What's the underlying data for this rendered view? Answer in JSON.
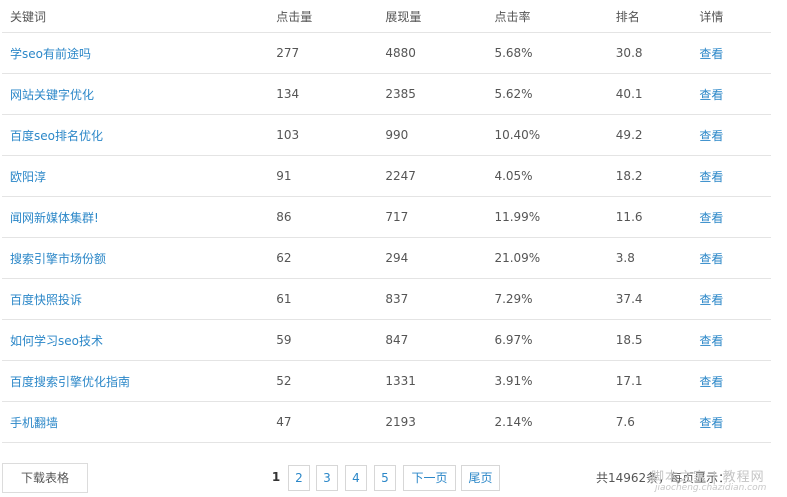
{
  "table": {
    "headers": [
      "关键词",
      "点击量",
      "展现量",
      "点击率",
      "排名",
      "详情"
    ],
    "rows": [
      {
        "keyword": "学seo有前途吗",
        "clicks": "277",
        "impressions": "4880",
        "ctr": "5.68%",
        "rank": "30.8",
        "action": "查看"
      },
      {
        "keyword": "网站关键字优化",
        "clicks": "134",
        "impressions": "2385",
        "ctr": "5.62%",
        "rank": "40.1",
        "action": "查看"
      },
      {
        "keyword": "百度seo排名优化",
        "clicks": "103",
        "impressions": "990",
        "ctr": "10.40%",
        "rank": "49.2",
        "action": "查看"
      },
      {
        "keyword": "欧阳淳",
        "clicks": "91",
        "impressions": "2247",
        "ctr": "4.05%",
        "rank": "18.2",
        "action": "查看"
      },
      {
        "keyword": "闻网新媒体集群!",
        "clicks": "86",
        "impressions": "717",
        "ctr": "11.99%",
        "rank": "11.6",
        "action": "查看"
      },
      {
        "keyword": "搜索引擎市场份额",
        "clicks": "62",
        "impressions": "294",
        "ctr": "21.09%",
        "rank": "3.8",
        "action": "查看"
      },
      {
        "keyword": "百度快照投诉",
        "clicks": "61",
        "impressions": "837",
        "ctr": "7.29%",
        "rank": "37.4",
        "action": "查看"
      },
      {
        "keyword": "如何学习seo技术",
        "clicks": "59",
        "impressions": "847",
        "ctr": "6.97%",
        "rank": "18.5",
        "action": "查看"
      },
      {
        "keyword": "百度搜索引擎优化指南",
        "clicks": "52",
        "impressions": "1331",
        "ctr": "3.91%",
        "rank": "17.1",
        "action": "查看"
      },
      {
        "keyword": "手机翻墙",
        "clicks": "47",
        "impressions": "2193",
        "ctr": "2.14%",
        "rank": "7.6",
        "action": "查看"
      }
    ]
  },
  "footer": {
    "download_label": "下载表格",
    "pages": [
      "1",
      "2",
      "3",
      "4",
      "5"
    ],
    "current_page": "1",
    "next_label": "下一页",
    "last_label": "尾页",
    "total_text": "共14962条，每页显示："
  },
  "watermark": {
    "text": "脚本之家 | 教程网",
    "sub": "jiaocheng.chazidian.com"
  },
  "colors": {
    "link": "#2b87c8",
    "text": "#555555",
    "border": "#e4e4e4"
  }
}
